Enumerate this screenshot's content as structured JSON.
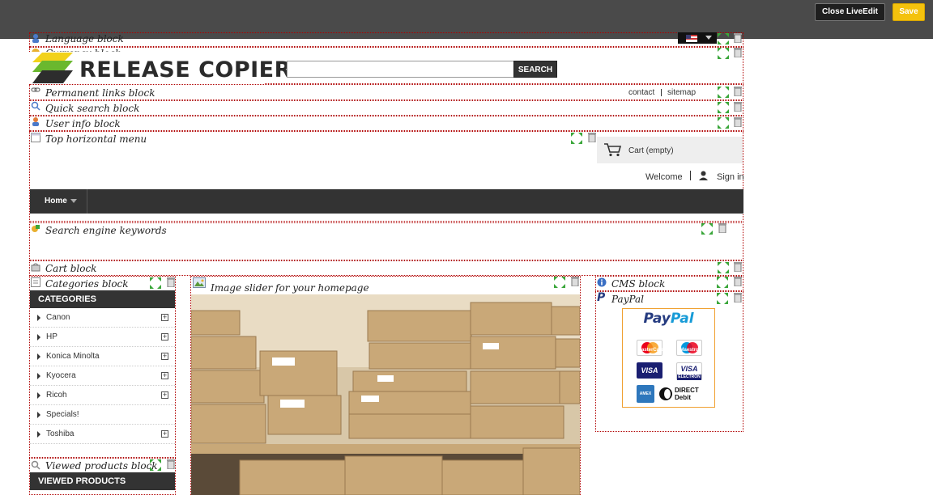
{
  "toolbar": {
    "close_label": "Close LiveEdit",
    "save_label": "Save"
  },
  "blocks": {
    "language": "Language block",
    "currency": "Currency block",
    "permanent_links": "Permanent links block",
    "quick_search": "Quick search block",
    "user_info": "User info block",
    "top_menu": "Top horizontal menu",
    "seo_keywords": "Search engine keywords",
    "cart": "Cart block",
    "categories": "Categories block",
    "slider": "Image slider for your homepage",
    "cms": "CMS block",
    "paypal": "PayPal",
    "viewed_products": "Viewed products block"
  },
  "logo": {
    "text": "RELEASE COPIER"
  },
  "search": {
    "placeholder": "",
    "button": "SEARCH"
  },
  "permanent_links": {
    "contact": "contact",
    "sitemap": "sitemap"
  },
  "header": {
    "cart_text": "Cart (empty)",
    "welcome": "Welcome",
    "sign_in": "Sign in"
  },
  "nav": {
    "home": "Home"
  },
  "categories": {
    "title": "CATEGORIES",
    "items": [
      {
        "label": "Canon",
        "expandable": true
      },
      {
        "label": "HP",
        "expandable": true
      },
      {
        "label": "Konica Minolta",
        "expandable": true
      },
      {
        "label": "Kyocera",
        "expandable": true
      },
      {
        "label": "Ricoh",
        "expandable": true
      },
      {
        "label": "Specials!",
        "expandable": false
      },
      {
        "label": "Toshiba",
        "expandable": true
      }
    ]
  },
  "viewed_products": {
    "title": "VIEWED PRODUCTS"
  },
  "paypal": {
    "logo_pay": "Pay",
    "logo_pal": "Pal",
    "cards": [
      "MasterCard",
      "Maestro",
      "VISA",
      "VISA",
      "AMEX",
      "DIRECT Debit"
    ],
    "card_electron": "ELECTRON",
    "direct": "DIRECT",
    "debit": "Debit"
  },
  "colors": {
    "topbar": "#4a4a4a",
    "save": "#f4c20d",
    "nav": "#333333",
    "block_border": "#b00000",
    "move_icon": "#3aa63a"
  }
}
